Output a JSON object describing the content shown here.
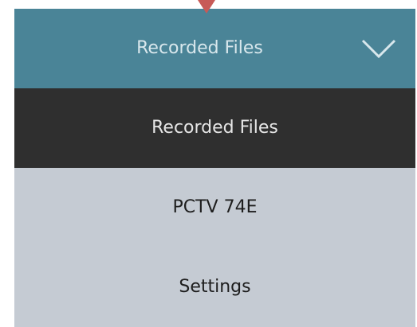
{
  "dropdown": {
    "selected_label": "Recorded Files",
    "toggle_icon": "chevron-down-icon",
    "items": [
      {
        "label": "Recorded Files",
        "selected": true
      },
      {
        "label": "PCTV 74E",
        "selected": false
      },
      {
        "label": "Settings",
        "selected": false
      }
    ]
  },
  "colors": {
    "header_bg": "#4a8497",
    "selected_bg": "#2f2f2f",
    "item_bg": "#c5cbd3",
    "pointer": "#c75a57"
  }
}
